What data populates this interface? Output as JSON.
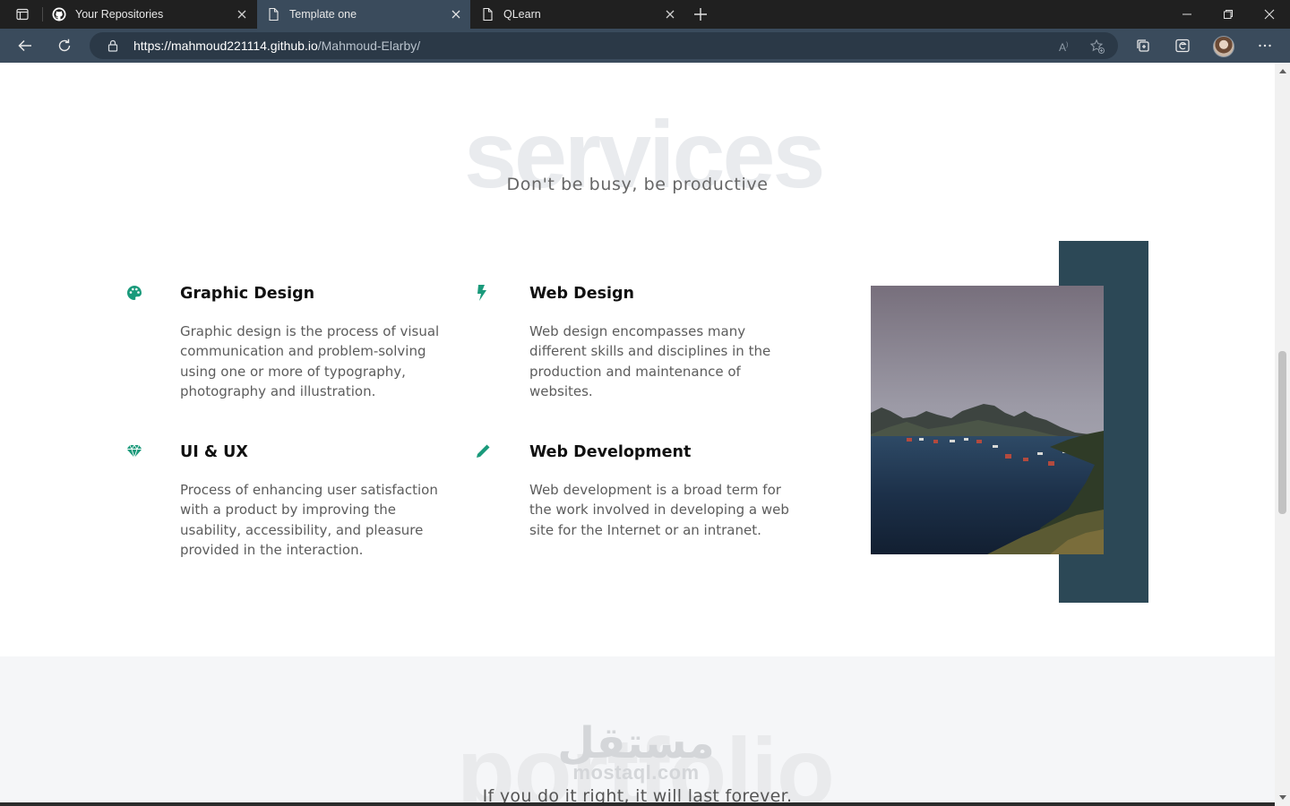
{
  "browser": {
    "tabs": [
      {
        "title": "Your Repositories",
        "icon": "github-icon",
        "active": false
      },
      {
        "title": "Template one",
        "icon": "page-icon",
        "active": true
      },
      {
        "title": "QLearn",
        "icon": "page-icon",
        "active": false
      }
    ],
    "url_host": "https://mahmoud221114.github.io",
    "url_path": "/Mahmoud-Elarby/"
  },
  "services": {
    "bg_title": "services",
    "subtitle": "Don't be busy, be productive",
    "items": [
      {
        "title": "Graphic Design",
        "icon": "palette-icon",
        "desc": "Graphic design is the process of visual communication and problem-solving using one or more of typography, photography and illustration."
      },
      {
        "title": "Web Design",
        "icon": "bolt-icon",
        "desc": "Web design encompasses many different skills and disciplines in the production and maintenance of websites."
      },
      {
        "title": "UI & UX",
        "icon": "gem-icon",
        "desc": "Process of enhancing user satisfaction with a product by improving the usability, accessibility, and pleasure provided in the interaction."
      },
      {
        "title": "Web Development",
        "icon": "pencil-icon",
        "desc": "Web development is a broad term for the work involved in developing a web site for the Internet or an intranet."
      }
    ]
  },
  "portfolio": {
    "bg_title": "portfolio",
    "subtitle": "If you do it right, it will last forever."
  },
  "watermark": {
    "arabic": "مستقل",
    "latin": "mostaql.com"
  },
  "colors": {
    "accent": "#1a9a7b",
    "image_backdrop": "#2c4856",
    "browser_active": "#3a4b5c"
  }
}
